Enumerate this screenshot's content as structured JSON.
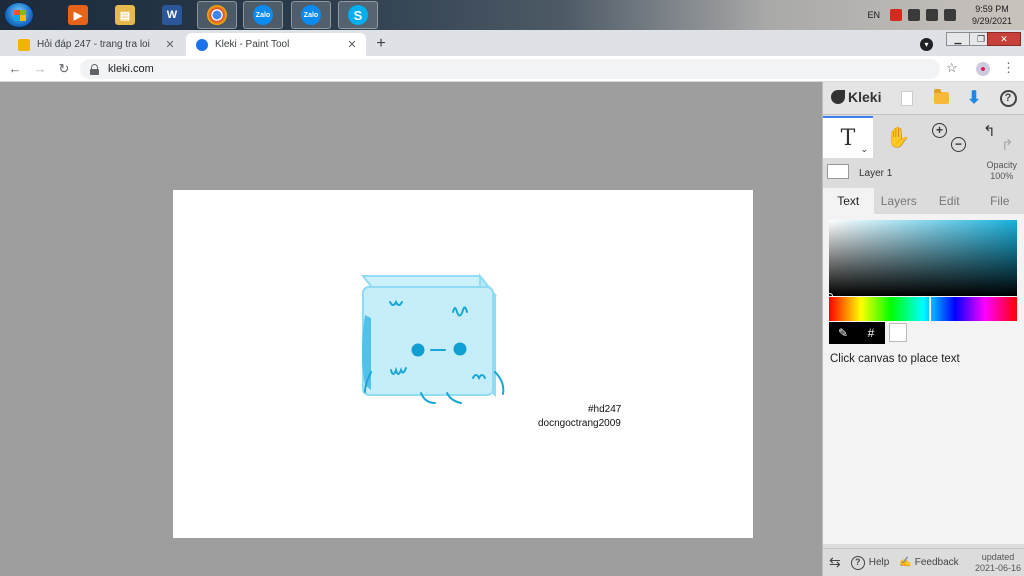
{
  "taskbar": {
    "apps": [
      {
        "name": "media-player",
        "glyph": "▶",
        "color": "#e8631a"
      },
      {
        "name": "file-explorer",
        "glyph": "▤",
        "color": "#e7b94c"
      },
      {
        "name": "word",
        "glyph": "W",
        "color": "#2b579a"
      },
      {
        "name": "chrome",
        "glyph": "●",
        "color": "#2e9b45"
      },
      {
        "name": "zalo",
        "glyph": "Zalo",
        "color": "#0a8bf0"
      },
      {
        "name": "zalo-2",
        "glyph": "Zalo",
        "color": "#0a8bf0"
      },
      {
        "name": "skype",
        "glyph": "S",
        "color": "#00aff0"
      }
    ],
    "language": "EN",
    "time": "9:59 PM",
    "date": "9/29/2021"
  },
  "browser": {
    "tabs": [
      {
        "title": "Hỏi đáp 247 - trang tra loi",
        "favicon_color": "#f4b400"
      },
      {
        "title": "Kleki - Paint Tool",
        "favicon_color": "#1a73e8"
      }
    ],
    "url": "kleki.com"
  },
  "canvas": {
    "text_lines": [
      "#hd247",
      "docngoctrang2009"
    ]
  },
  "kleki": {
    "brand": "Kleki",
    "tool_text_glyph": "T",
    "layer_name": "Layer 1",
    "opacity_label": "Opacity",
    "opacity_value": "100%",
    "tabs": [
      "Text",
      "Layers",
      "Edit",
      "File"
    ],
    "hex_symbol": "#",
    "hint": "Click canvas to place text",
    "footer": {
      "help": "Help",
      "feedback": "Feedback",
      "updated_label": "updated",
      "updated_date": "2021-06-16"
    },
    "accent_color": "#19b1dc"
  }
}
